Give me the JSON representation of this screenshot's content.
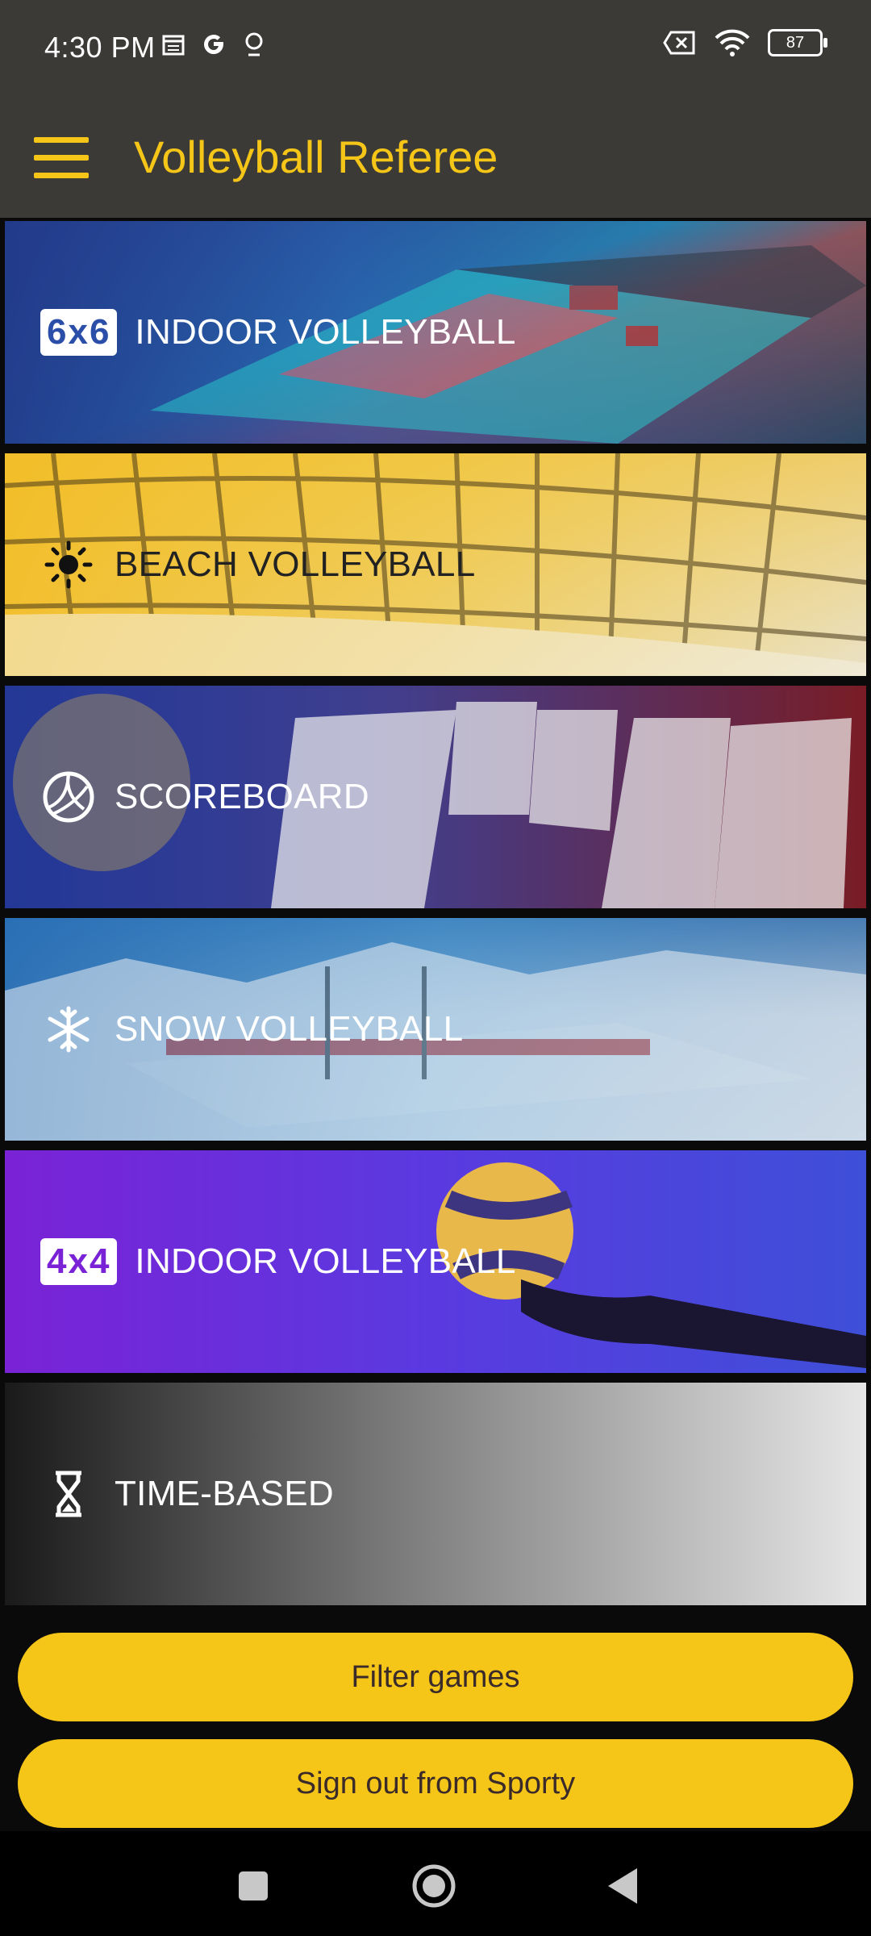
{
  "status": {
    "time": "4:30 PM",
    "battery": "87",
    "left_icons": [
      "calendar-icon",
      "google-icon",
      "location-icon"
    ],
    "right_icons": [
      "sim-off-icon",
      "wifi-icon",
      "battery-icon"
    ]
  },
  "appbar": {
    "title": "Volleyball Referee",
    "menu_icon": "hamburger-menu-icon"
  },
  "games": [
    {
      "badge": "6x6",
      "label": "INDOOR VOLLEYBALL",
      "icon": "badge-6x6"
    },
    {
      "badge": "",
      "label": "BEACH VOLLEYBALL",
      "icon": "sun-icon"
    },
    {
      "badge": "",
      "label": "SCOREBOARD",
      "icon": "volleyball-icon"
    },
    {
      "badge": "",
      "label": "SNOW VOLLEYBALL",
      "icon": "snowflake-icon"
    },
    {
      "badge": "4x4",
      "label": "INDOOR VOLLEYBALL",
      "icon": "badge-4x4"
    },
    {
      "badge": "",
      "label": "TIME-BASED",
      "icon": "hourglass-icon"
    }
  ],
  "buttons": {
    "filter": "Filter games",
    "signout": "Sign out from Sporty"
  },
  "colors": {
    "accent": "#f5c518",
    "bar": "#3b3a36"
  }
}
